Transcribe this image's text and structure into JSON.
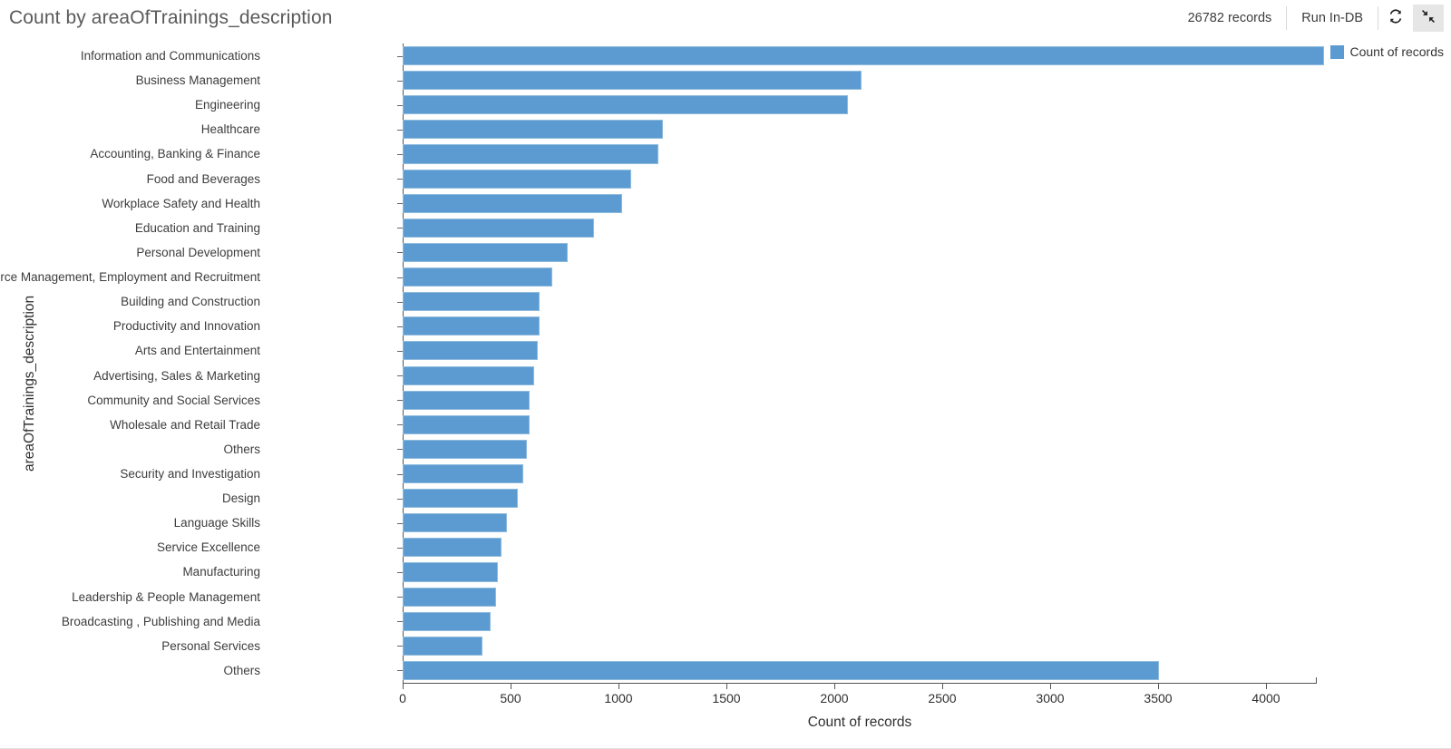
{
  "header": {
    "title": "Count by areaOfTrainings_description",
    "records_label": "26782 records",
    "run_button_label": "Run In-DB",
    "refresh_icon": "refresh-icon",
    "collapse_icon": "collapse-arrows-icon"
  },
  "legend": {
    "entries": [
      {
        "label": "Count of records",
        "color": "#5b9bd1"
      }
    ],
    "position": "top-right"
  },
  "colors": {
    "bar_fill": "#5b9bd1",
    "bar_stroke": "#8fbbdd",
    "axis": "#555555",
    "title_text": "#5a5a5a",
    "label_text": "#3d3d3d"
  },
  "chart_data": {
    "type": "bar",
    "orientation": "horizontal",
    "title": "Count by areaOfTrainings_description",
    "xlabel": "Count of records",
    "ylabel": "areaOfTrainings_description",
    "xlim": [
      0,
      4290
    ],
    "xticks": [
      0,
      500,
      1000,
      1500,
      2000,
      2500,
      3000,
      3500,
      4000
    ],
    "grid": false,
    "legend": [
      "Count of records"
    ],
    "categories": [
      "Information and Communications",
      "Business Management",
      "Engineering",
      "Healthcare",
      "Accounting, Banking & Finance",
      "Food and Beverages",
      "Workplace Safety and Health",
      "Education and Training",
      "Personal Development",
      "Human Resource Management, Employment and Recruitment",
      "Building and Construction",
      "Productivity and Innovation",
      "Arts and Entertainment",
      "Advertising, Sales & Marketing",
      "Community and Social Services",
      "Wholesale and Retail Trade",
      "Others",
      "Security and Investigation",
      "Design",
      "Language Skills",
      "Service Excellence",
      "Manufacturing",
      "Leadership & People Management",
      "Broadcasting , Publishing and Media",
      "Personal Services",
      "Others"
    ],
    "values": [
      4270,
      2128,
      2065,
      1205,
      1185,
      1058,
      1015,
      888,
      765,
      693,
      634,
      634,
      626,
      609,
      588,
      588,
      575,
      558,
      533,
      482,
      457,
      440,
      431,
      406,
      368,
      3505
    ],
    "series": [
      {
        "name": "Count of records",
        "values": [
          4270,
          2128,
          2065,
          1205,
          1185,
          1058,
          1015,
          888,
          765,
          693,
          634,
          634,
          626,
          609,
          588,
          588,
          575,
          558,
          533,
          482,
          457,
          440,
          431,
          406,
          368,
          3505
        ]
      }
    ]
  }
}
